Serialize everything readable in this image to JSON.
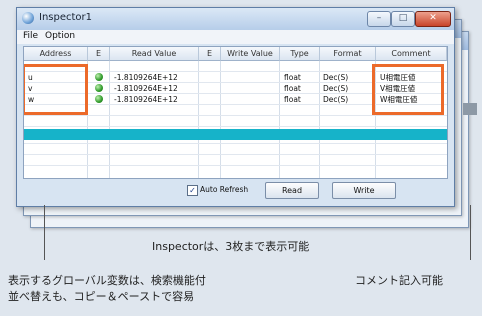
{
  "window": {
    "title": "Inspector1",
    "controls": {
      "minimize": "–",
      "maximize": "□",
      "close": "✕"
    }
  },
  "menu": [
    "File",
    "Option"
  ],
  "grid": {
    "columns": [
      "Address",
      "E",
      "Read Value",
      "E",
      "Write Value",
      "Type",
      "Format",
      "Comment"
    ],
    "rows": [
      {
        "address": "u",
        "read_value": "-1.8109264E+12",
        "type": "float",
        "format": "Dec(S)",
        "comment": "U相電圧値"
      },
      {
        "address": "v",
        "read_value": "-1.8109264E+12",
        "type": "float",
        "format": "Dec(S)",
        "comment": "V相電圧値"
      },
      {
        "address": "w",
        "read_value": "-1.8109264E+12",
        "type": "float",
        "format": "Dec(S)",
        "comment": "W相電圧値"
      }
    ],
    "status_color": "#2f9a2a",
    "selected_row_color": "#16b3c9"
  },
  "footer": {
    "auto_refresh_label": "Auto Refresh",
    "auto_refresh_checked": true,
    "read_button": "Read",
    "write_button": "Write"
  },
  "highlight_color": "#ec6a2a",
  "annotations": {
    "inspector_note": "Inspectorは、3枚まで表示可能",
    "global_var_note_line1": "表示するグローバル変数は、検索機能付",
    "global_var_note_line2": "並べ替えも、コピー＆ペーストで容易",
    "comment_note": "コメント記入可能"
  }
}
